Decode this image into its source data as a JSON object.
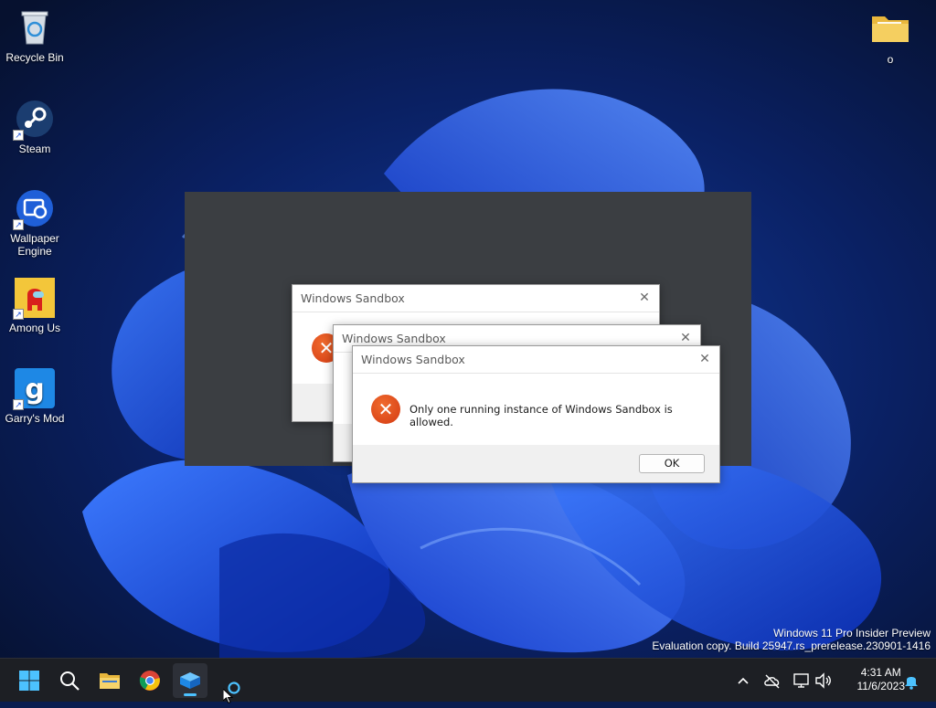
{
  "desktop": {
    "icons": [
      {
        "id": "recycle-bin",
        "label": "Recycle Bin",
        "icon": "recycle-bin-icon"
      },
      {
        "id": "steam",
        "label": "Steam",
        "icon": "steam-icon"
      },
      {
        "id": "wallpaper-engine",
        "label": "Wallpaper Engine",
        "icon": "wallpaper-engine-icon"
      },
      {
        "id": "among-us",
        "label": "Among Us",
        "icon": "among-us-icon"
      },
      {
        "id": "garrys-mod",
        "label": "Garry's Mod",
        "icon": "garrys-mod-icon"
      },
      {
        "id": "folder-o",
        "label": "o",
        "icon": "folder-icon"
      }
    ],
    "watermark": {
      "line1": "Windows 11 Pro Insider Preview",
      "line2": "Evaluation copy. Build 25947.rs_prerelease.230901-1416"
    }
  },
  "dialogs": [
    {
      "title": "Windows Sandbox",
      "close": "✕"
    },
    {
      "title": "Windows Sandbox",
      "close": "✕"
    },
    {
      "title": "Windows Sandbox",
      "close": "✕",
      "message": "Only one running instance of Windows Sandbox is allowed.",
      "ok_label": "OK",
      "error_glyph": "✕"
    }
  ],
  "taskbar": {
    "apps": [
      "start-icon",
      "search-icon",
      "file-explorer-icon",
      "chrome-icon",
      "windows-sandbox-icon"
    ],
    "clock": {
      "time": "4:31 AM",
      "date": "11/6/2023"
    },
    "tray": [
      "chevron-up-icon",
      "onedrive-offline-icon",
      "network-icon",
      "volume-icon",
      "notification-bell-icon"
    ]
  },
  "colors": {
    "accent": "#4cc2ff",
    "error": "#d9431a",
    "taskbar": "#1d1f24"
  }
}
